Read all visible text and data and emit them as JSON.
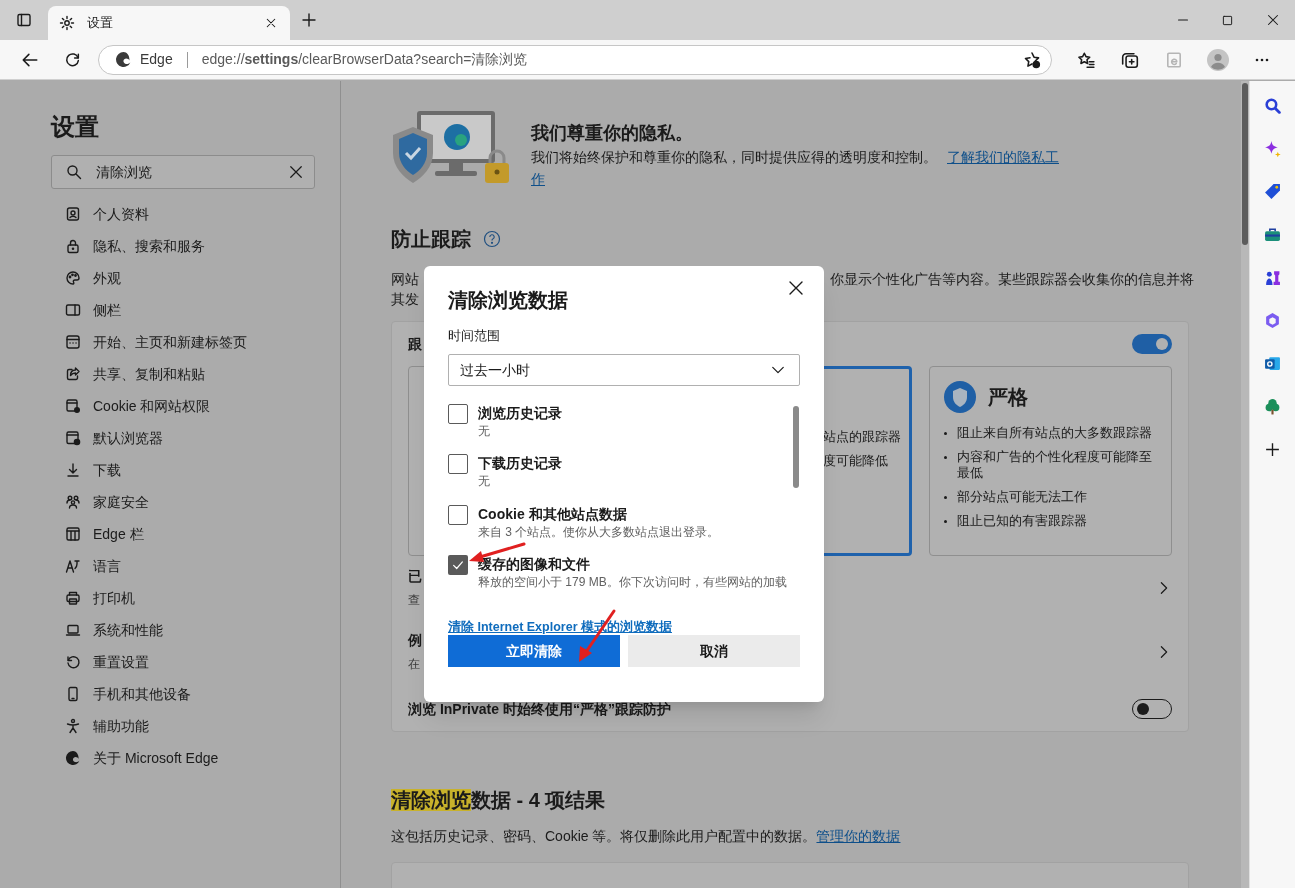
{
  "tab": {
    "title": "设置"
  },
  "address": {
    "site": "Edge",
    "url": "edge://**settings**/clearBrowserData?search=清除浏览"
  },
  "settings_nav": {
    "title": "设置",
    "search": {
      "value": "清除浏览"
    },
    "items": [
      {
        "kind": "profile",
        "label": "个人资料"
      },
      {
        "kind": "lock",
        "label": "隐私、搜索和服务"
      },
      {
        "kind": "palette",
        "label": "外观"
      },
      {
        "kind": "sidebar",
        "label": "侧栏"
      },
      {
        "kind": "home",
        "label": "开始、主页和新建标签页"
      },
      {
        "kind": "share",
        "label": "共享、复制和粘贴"
      },
      {
        "kind": "cookie",
        "label": "Cookie 和网站权限"
      },
      {
        "kind": "browser",
        "label": "默认浏览器"
      },
      {
        "kind": "download",
        "label": "下载"
      },
      {
        "kind": "family",
        "label": "家庭安全"
      },
      {
        "kind": "edgebar",
        "label": "Edge 栏"
      },
      {
        "kind": "language",
        "label": "语言"
      },
      {
        "kind": "printer",
        "label": "打印机"
      },
      {
        "kind": "laptop",
        "label": "系统和性能"
      },
      {
        "kind": "reset",
        "label": "重置设置"
      },
      {
        "kind": "phone",
        "label": "手机和其他设备"
      },
      {
        "kind": "accessibility",
        "label": "辅助功能"
      },
      {
        "kind": "edge",
        "label": "关于 Microsoft Edge"
      }
    ]
  },
  "privacy": {
    "title": "我们尊重你的隐私。",
    "text": "我们将始终保护和尊重你的隐私，同时提供应得的透明度和控制。",
    "link_line1": "了解我们的隐私工",
    "link_line2": "作"
  },
  "tracking": {
    "title": "防止跟踪",
    "desc_left": [
      "网站",
      "其发"
    ],
    "desc_right": "你显示个性化广告等内容。某些跟踪器会收集你的信息并将",
    "card_title": "跟",
    "on": true,
    "levels": [
      {
        "selected": false
      },
      {
        "selected": true,
        "lines": [
          "站点的跟踪器",
          "度可能降低"
        ]
      },
      {
        "selected": false,
        "title": "严格",
        "lines": [
          "阻止来自所有站点的大多数跟踪器",
          "内容和广告的个性化程度可能降至最低",
          "部分站点可能无法工作",
          "阻止已知的有害跟踪器"
        ]
      }
    ],
    "rows": [
      {
        "title": "已",
        "sub": "查"
      },
      {
        "title": "例",
        "sub": "在"
      }
    ],
    "inprivate": {
      "label": "浏览 InPrivate 时始终使用“严格”跟踪防护",
      "on": false
    }
  },
  "results": {
    "highlight": "清除浏览",
    "rest": "数据 - 4 项结果",
    "text": "这包括历史记录、密码、Cookie 等。将仅删除此用户配置中的数据。",
    "link": "管理你的数据"
  },
  "dialog": {
    "title": "清除浏览数据",
    "range_label": "时间范围",
    "range_value": "过去一小时",
    "items": [
      {
        "label": "浏览历史记录",
        "detail": "无",
        "checked": false
      },
      {
        "label": "下载历史记录",
        "detail": "无",
        "checked": false
      },
      {
        "label": "Cookie 和其他站点数据",
        "detail": "来自 3 个站点。使你从大多数站点退出登录。",
        "checked": false
      },
      {
        "label": "缓存的图像和文件",
        "detail": "释放的空间小于 179 MB。你下次访问时，有些网站的加载",
        "checked": true
      }
    ],
    "ie_link": "清除 Internet Explorer 模式的浏览数据",
    "primary": "立即清除",
    "cancel": "取消"
  },
  "annotations": [
    {
      "kind": "arrow"
    },
    {
      "kind": "arrow"
    }
  ]
}
